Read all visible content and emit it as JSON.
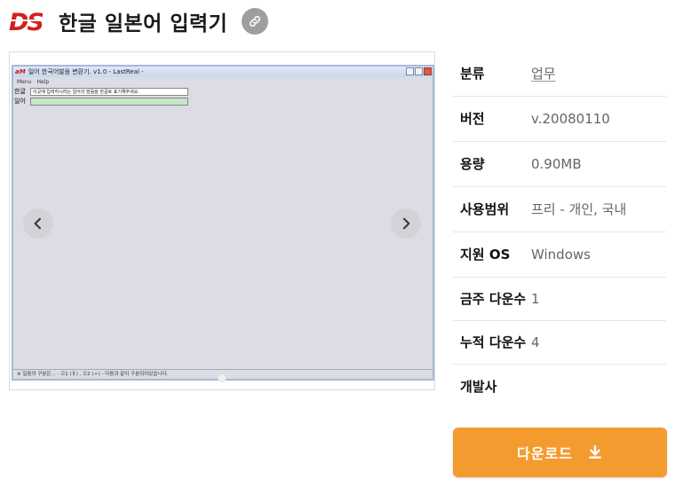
{
  "header": {
    "logo_text": "DS",
    "title": "한글 일본어 입력기"
  },
  "screenshot": {
    "window_title": "일어 한국어발음 변환기. v1.0 - LastReal -",
    "app_icon_text": "aM",
    "menu": [
      "Menu",
      "Help"
    ],
    "rows": [
      {
        "label": "한글",
        "value": "이곳에 입력하시려는 일어의 발음을 한글로 표기해주세요."
      },
      {
        "label": "일어",
        "value": ""
      }
    ],
    "status": "※ 일음의 구분은... - 으1 (ㅐ) , 으2 (ㅅ) - 다음과 같이 구분되어있습니다."
  },
  "info": {
    "rows": [
      {
        "key": "분류",
        "value": "업무"
      },
      {
        "key": "버전",
        "value": "v.20080110"
      },
      {
        "key": "용량",
        "value": "0.90MB"
      },
      {
        "key": "사용범위",
        "value": "프리 - 개인, 국내"
      },
      {
        "key": "지원 OS",
        "value": "Windows"
      },
      {
        "key": "금주 다운수",
        "value": "1"
      },
      {
        "key": "누적 다운수",
        "value": "4"
      },
      {
        "key": "개발사",
        "value": ""
      }
    ]
  },
  "download": {
    "label": "다운로드"
  },
  "colors": {
    "accent": "#f49b2f",
    "logo_red": "#d21f1f"
  },
  "icons": {
    "link": "link-icon",
    "prev": "chevron-left-icon",
    "next": "chevron-right-icon",
    "download": "download-icon"
  }
}
